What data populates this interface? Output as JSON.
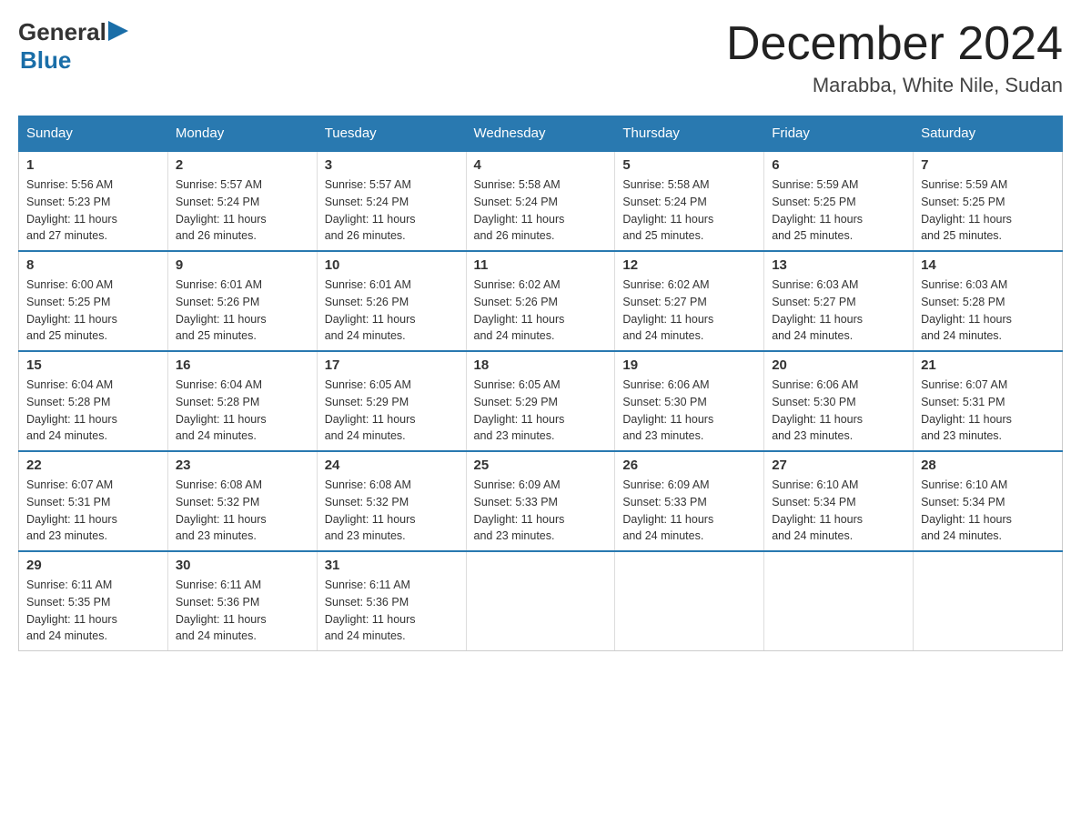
{
  "header": {
    "logo_general": "General",
    "logo_blue": "Blue",
    "month_year": "December 2024",
    "location": "Marabba, White Nile, Sudan"
  },
  "weekdays": [
    "Sunday",
    "Monday",
    "Tuesday",
    "Wednesday",
    "Thursday",
    "Friday",
    "Saturday"
  ],
  "weeks": [
    [
      {
        "day": "1",
        "sunrise": "5:56 AM",
        "sunset": "5:23 PM",
        "daylight": "11 hours and 27 minutes."
      },
      {
        "day": "2",
        "sunrise": "5:57 AM",
        "sunset": "5:24 PM",
        "daylight": "11 hours and 26 minutes."
      },
      {
        "day": "3",
        "sunrise": "5:57 AM",
        "sunset": "5:24 PM",
        "daylight": "11 hours and 26 minutes."
      },
      {
        "day": "4",
        "sunrise": "5:58 AM",
        "sunset": "5:24 PM",
        "daylight": "11 hours and 26 minutes."
      },
      {
        "day": "5",
        "sunrise": "5:58 AM",
        "sunset": "5:24 PM",
        "daylight": "11 hours and 25 minutes."
      },
      {
        "day": "6",
        "sunrise": "5:59 AM",
        "sunset": "5:25 PM",
        "daylight": "11 hours and 25 minutes."
      },
      {
        "day": "7",
        "sunrise": "5:59 AM",
        "sunset": "5:25 PM",
        "daylight": "11 hours and 25 minutes."
      }
    ],
    [
      {
        "day": "8",
        "sunrise": "6:00 AM",
        "sunset": "5:25 PM",
        "daylight": "11 hours and 25 minutes."
      },
      {
        "day": "9",
        "sunrise": "6:01 AM",
        "sunset": "5:26 PM",
        "daylight": "11 hours and 25 minutes."
      },
      {
        "day": "10",
        "sunrise": "6:01 AM",
        "sunset": "5:26 PM",
        "daylight": "11 hours and 24 minutes."
      },
      {
        "day": "11",
        "sunrise": "6:02 AM",
        "sunset": "5:26 PM",
        "daylight": "11 hours and 24 minutes."
      },
      {
        "day": "12",
        "sunrise": "6:02 AM",
        "sunset": "5:27 PM",
        "daylight": "11 hours and 24 minutes."
      },
      {
        "day": "13",
        "sunrise": "6:03 AM",
        "sunset": "5:27 PM",
        "daylight": "11 hours and 24 minutes."
      },
      {
        "day": "14",
        "sunrise": "6:03 AM",
        "sunset": "5:28 PM",
        "daylight": "11 hours and 24 minutes."
      }
    ],
    [
      {
        "day": "15",
        "sunrise": "6:04 AM",
        "sunset": "5:28 PM",
        "daylight": "11 hours and 24 minutes."
      },
      {
        "day": "16",
        "sunrise": "6:04 AM",
        "sunset": "5:28 PM",
        "daylight": "11 hours and 24 minutes."
      },
      {
        "day": "17",
        "sunrise": "6:05 AM",
        "sunset": "5:29 PM",
        "daylight": "11 hours and 24 minutes."
      },
      {
        "day": "18",
        "sunrise": "6:05 AM",
        "sunset": "5:29 PM",
        "daylight": "11 hours and 23 minutes."
      },
      {
        "day": "19",
        "sunrise": "6:06 AM",
        "sunset": "5:30 PM",
        "daylight": "11 hours and 23 minutes."
      },
      {
        "day": "20",
        "sunrise": "6:06 AM",
        "sunset": "5:30 PM",
        "daylight": "11 hours and 23 minutes."
      },
      {
        "day": "21",
        "sunrise": "6:07 AM",
        "sunset": "5:31 PM",
        "daylight": "11 hours and 23 minutes."
      }
    ],
    [
      {
        "day": "22",
        "sunrise": "6:07 AM",
        "sunset": "5:31 PM",
        "daylight": "11 hours and 23 minutes."
      },
      {
        "day": "23",
        "sunrise": "6:08 AM",
        "sunset": "5:32 PM",
        "daylight": "11 hours and 23 minutes."
      },
      {
        "day": "24",
        "sunrise": "6:08 AM",
        "sunset": "5:32 PM",
        "daylight": "11 hours and 23 minutes."
      },
      {
        "day": "25",
        "sunrise": "6:09 AM",
        "sunset": "5:33 PM",
        "daylight": "11 hours and 23 minutes."
      },
      {
        "day": "26",
        "sunrise": "6:09 AM",
        "sunset": "5:33 PM",
        "daylight": "11 hours and 24 minutes."
      },
      {
        "day": "27",
        "sunrise": "6:10 AM",
        "sunset": "5:34 PM",
        "daylight": "11 hours and 24 minutes."
      },
      {
        "day": "28",
        "sunrise": "6:10 AM",
        "sunset": "5:34 PM",
        "daylight": "11 hours and 24 minutes."
      }
    ],
    [
      {
        "day": "29",
        "sunrise": "6:11 AM",
        "sunset": "5:35 PM",
        "daylight": "11 hours and 24 minutes."
      },
      {
        "day": "30",
        "sunrise": "6:11 AM",
        "sunset": "5:36 PM",
        "daylight": "11 hours and 24 minutes."
      },
      {
        "day": "31",
        "sunrise": "6:11 AM",
        "sunset": "5:36 PM",
        "daylight": "11 hours and 24 minutes."
      },
      null,
      null,
      null,
      null
    ]
  ],
  "labels": {
    "sunrise": "Sunrise:",
    "sunset": "Sunset:",
    "daylight": "Daylight:"
  }
}
